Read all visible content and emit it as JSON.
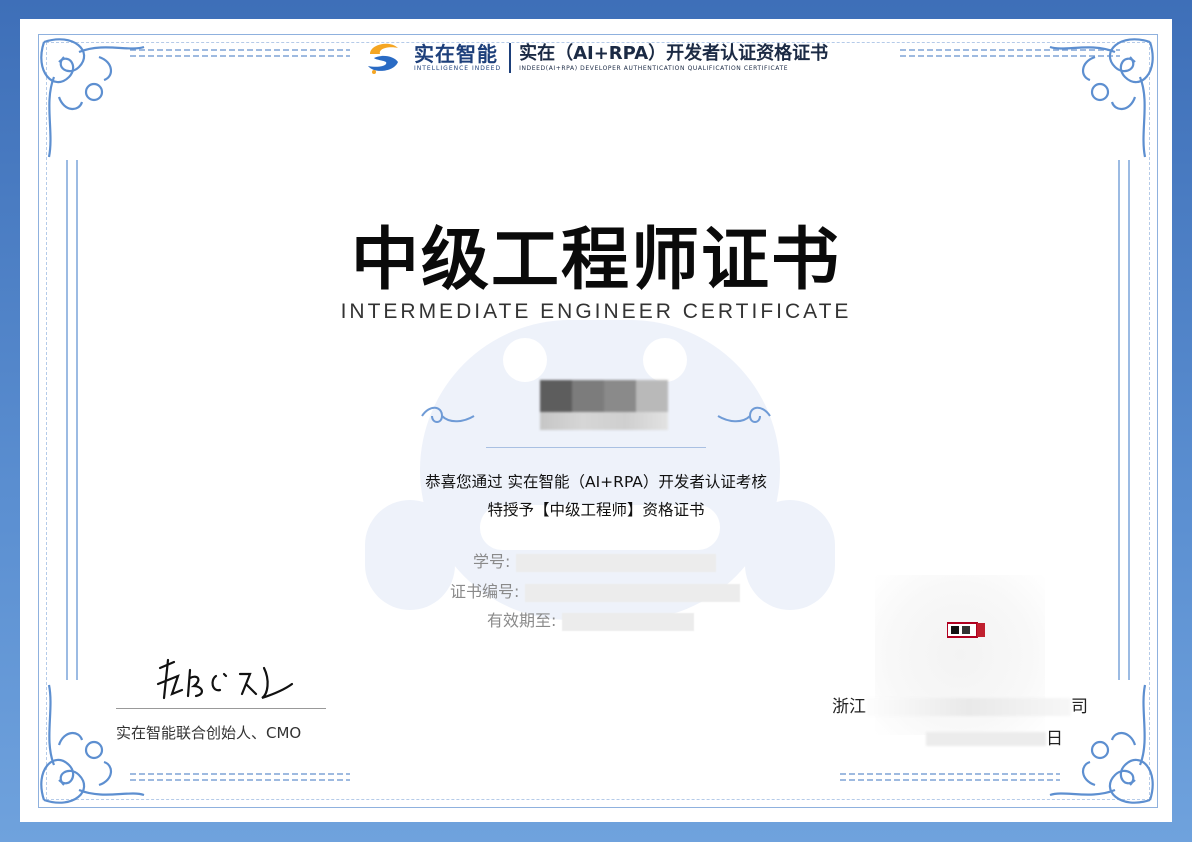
{
  "header": {
    "brand_cn": "实在智能",
    "brand_en": "INTELLIGENCE INDEED",
    "cert_name_cn": "实在（AI+RPA）开发者认证资格证书",
    "cert_name_en": "INDEED(AI+RPA) DEVELOPER AUTHENTICATION QUALIFICATION CERTIFICATE"
  },
  "title": {
    "cn": "中级工程师证书",
    "en": "INTERMEDIATE ENGINEER CERTIFICATE"
  },
  "recipient": {
    "name": ""
  },
  "body": {
    "line1": "恭喜您通过 实在智能（AI+RPA）开发者认证考核",
    "line2": "特授予【中级工程师】资格证书"
  },
  "fields": {
    "student_id_label": "学号:",
    "student_id_value": "",
    "cert_no_label": "证书编号:",
    "cert_no_value": "",
    "valid_until_label": "有效期至:",
    "valid_until_value": ""
  },
  "signature": {
    "caption": "实在智能联合创始人、CMO"
  },
  "issuer": {
    "company_prefix": "浙江",
    "company_suffix": "司",
    "date_suffix": "日"
  },
  "colors": {
    "page_background": "#3e6fb8",
    "border": "#8fb1de",
    "brand": "#1d3f7a",
    "watermark": "#eef2fa"
  }
}
